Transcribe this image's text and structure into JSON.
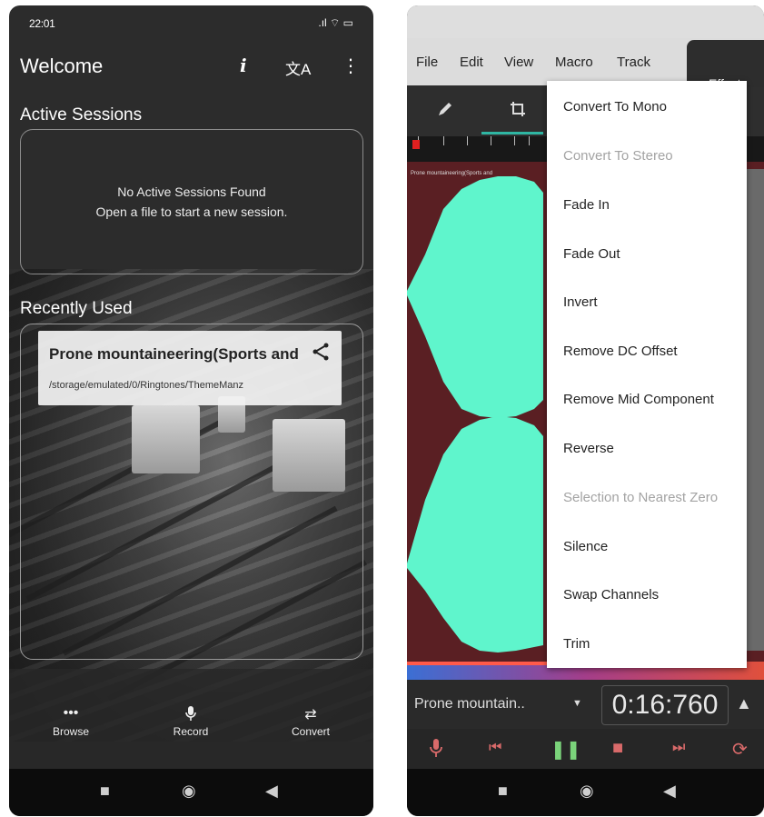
{
  "left_phone": {
    "status_time": "22:01",
    "status_icons": ".ıl ⌔ ▭",
    "title": "Welcome",
    "info_icon": "i",
    "translate_icon": "文A",
    "more_icon": "⋮",
    "active_sessions_label": "Active Sessions",
    "no_sessions_line1": "No Active Sessions Found",
    "no_sessions_line2": "Open a file to start a new session.",
    "recently_used_label": "Recently Used",
    "recent_file": {
      "name": "Prone mountaineering(Sports and",
      "path": "/storage/emulated/0/Ringtones/ThemeManz"
    },
    "bottom_nav": [
      {
        "label": "Browse",
        "icon": "•••"
      },
      {
        "label": "Record",
        "icon": "🎙"
      },
      {
        "label": "Convert",
        "icon": "⇄"
      }
    ]
  },
  "right_phone": {
    "menu": [
      "File",
      "Edit",
      "View",
      "Macro",
      "Track"
    ],
    "effects_label": "Effects",
    "waveform_caption": "Prone mountaineering(Sports and",
    "track_name": "Prone mountain..",
    "time_display": "0:16:760",
    "waveform_color": "#5ff5cc",
    "effects_menu": [
      {
        "label": "Convert To Mono",
        "enabled": true
      },
      {
        "label": "Convert To Stereo",
        "enabled": false
      },
      {
        "label": "Fade In",
        "enabled": true
      },
      {
        "label": "Fade Out",
        "enabled": true
      },
      {
        "label": "Invert",
        "enabled": true
      },
      {
        "label": "Remove DC Offset",
        "enabled": true
      },
      {
        "label": "Remove Mid Component",
        "enabled": true
      },
      {
        "label": "Reverse",
        "enabled": true
      },
      {
        "label": "Selection to Nearest Zero",
        "enabled": false
      },
      {
        "label": "Silence",
        "enabled": true
      },
      {
        "label": "Swap Channels",
        "enabled": true
      },
      {
        "label": "Trim",
        "enabled": true
      }
    ]
  }
}
